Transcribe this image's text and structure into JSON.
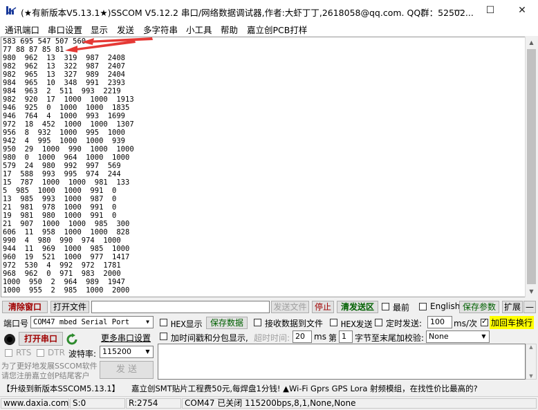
{
  "window": {
    "title": "(★有新版本V5.13.1★)SSCOM V5.12.2 串口/网络数据调试器,作者:大虾丁丁,2618058@qq.com. QQ群：52502...",
    "minimize": "—",
    "maximize": "☐",
    "close": "✕"
  },
  "menu": [
    "通讯端口",
    "串口设置",
    "显示",
    "发送",
    "多字符串",
    "小工具",
    "帮助",
    "嘉立创PCB打样"
  ],
  "receive_lines": [
    "583 695 547 507 560",
    "77 88 87 85 81",
    "980  962  13  319  987  2408",
    "982  962  13  322  987  2407",
    "982  965  13  327  989  2404",
    "984  965  10  348  991  2393",
    "984  963  2  511  993  2219",
    "982  920  17  1000  1000  1913",
    "946  925  0  1000  1000  1835",
    "946  764  4  1000  993  1699",
    "972  18  452  1000  1000  1307",
    "956  8  932  1000  995  1000",
    "942  4  995  1000  1000  939",
    "950  29  1000  990  1000  1000",
    "980  0  1000  964  1000  1000",
    "579  24  980  992  997  569",
    "17  588  993  995  974  244",
    "15  787  1000  1000  981  133",
    "5  985  1000  1000  991  0",
    "13  985  993  1000  987  0",
    "21  981  978  1000  991  0",
    "19  981  980  1000  991  0",
    "21  907  1000  1000  985  300",
    "606  11  958  1000  1000  828",
    "990  4  980  990  974  1000",
    "944  11  969  1000  985  1000",
    "960  19  521  1000  977  1417",
    "972  530  4  992  972  1781",
    "968  962  0  971  983  2000",
    "1000  950  2  964  989  1947",
    "1000  955  2  985  1000  2000"
  ],
  "toolbar1": {
    "clear_window": "清除窗口",
    "open_file": "打开文件",
    "send_file": "发送文件",
    "stop": "停止",
    "clear_send_area": "清发送区",
    "topmost": "最前",
    "english": "English",
    "save_params": "保存参数",
    "expand": "扩展",
    "collapse": "—"
  },
  "serial": {
    "port_label": "端口号",
    "port_value": "COM47 mbed Serial Port",
    "open_button": "打开串口",
    "more_settings": "更多串口设置",
    "rts": "RTS",
    "dtr": "DTR",
    "baud_label": "波特率:",
    "baud_value": "115200"
  },
  "options": {
    "hex_display": "HEX显示",
    "save_data": "保存数据",
    "recv_to_file": "接收数据到文件",
    "hex_send": "HEX发送",
    "timed_send": "定时发送:",
    "interval_value": "100",
    "interval_unit": "ms/次",
    "add_crlf": "加回车换行",
    "add_timestamp": "加时间戳和分包显示,",
    "timeout_label": "超时时间:",
    "timeout_value": "20",
    "timeout_unit": "ms",
    "byte_prefix": "第",
    "byte_index": "1",
    "checksum_label": "字节至末尾加校验:",
    "checksum_value": "None"
  },
  "promo": {
    "line1": "为了更好地发展SSCOM软件",
    "line2": "请您注册嘉立创P结尾客户",
    "send_button": "发  送"
  },
  "ticker": {
    "upgrade": "【升级到新版本SSCOM5.13.1】",
    "ad": "嘉立创SMT贴片工程费50元,每焊盘1分钱! ▲Wi-Fi Gprs GPS Lora 射频模组，在找性价比最高的?"
  },
  "status": {
    "website": "www.daxia.com",
    "sent": "S:0",
    "received": "R:2754",
    "port_info": "COM47 已关闭  115200bps,8,1,None,None"
  }
}
